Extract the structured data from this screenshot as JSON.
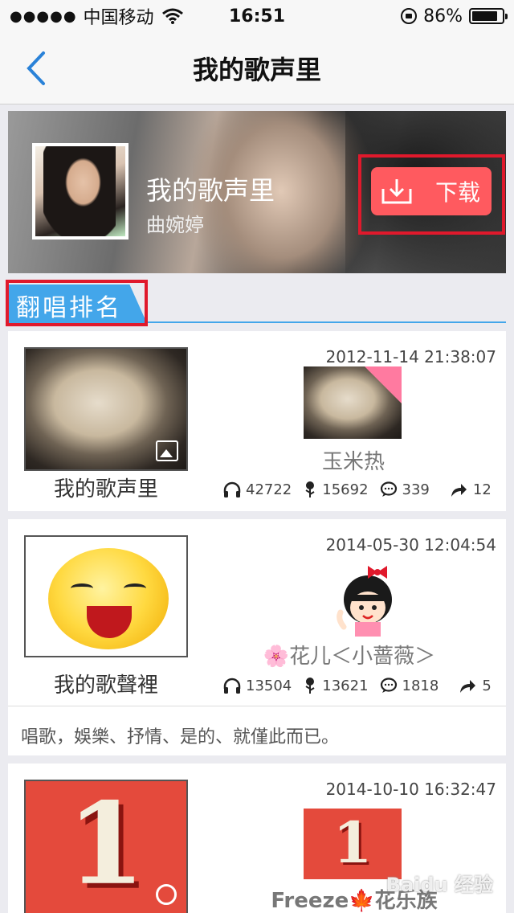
{
  "status_bar": {
    "signal": "●●●●●",
    "carrier": "中国移动",
    "time": "16:51",
    "battery": "86%",
    "battery_level": 0.86
  },
  "nav": {
    "title": "我的歌声里"
  },
  "banner": {
    "song": "我的歌声里",
    "artist": "曲婉婷",
    "download_label": "下载"
  },
  "section": {
    "title": "翻唱排名"
  },
  "covers": [
    {
      "song": "我的歌声里",
      "date": "2012-11-14 21:38:07",
      "singer": "玉米热",
      "plays": "42722",
      "flowers": "15692",
      "comments": "339",
      "shares": "12"
    },
    {
      "song": "我的歌聲裡",
      "date": "2014-05-30 12:04:54",
      "singer": "🌸花儿＜小蔷薇＞",
      "plays": "13504",
      "flowers": "13621",
      "comments": "1818",
      "shares": "5",
      "description": "唱歌，娛樂、抒情、是的、就僅此而已。"
    },
    {
      "date": "2014-10-10 16:32:47",
      "singer": "Freeze🍁花乐族",
      "numeral": "1"
    }
  ],
  "watermark": "Baidu 经验"
}
